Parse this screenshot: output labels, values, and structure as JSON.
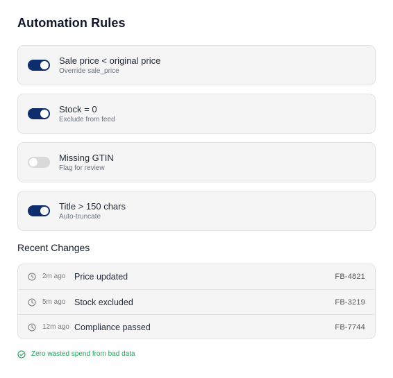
{
  "page": {
    "title": "Automation Rules"
  },
  "rules": [
    {
      "enabled": true,
      "title": "Sale price < original price",
      "subtitle": "Override sale_price"
    },
    {
      "enabled": true,
      "title": "Stock = 0",
      "subtitle": "Exclude from feed"
    },
    {
      "enabled": false,
      "title": "Missing GTIN",
      "subtitle": "Flag for review"
    },
    {
      "enabled": true,
      "title": "Title > 150 chars",
      "subtitle": "Auto-truncate"
    }
  ],
  "recent_changes": {
    "heading": "Recent Changes",
    "items": [
      {
        "time": "2m ago",
        "event": "Price updated",
        "id": "FB-4821"
      },
      {
        "time": "5m ago",
        "event": "Stock excluded",
        "id": "FB-3219"
      },
      {
        "time": "12m ago",
        "event": "Compliance passed",
        "id": "FB-7744"
      }
    ]
  },
  "footer": {
    "text": "Zero wasted spend from bad data",
    "icon": "check-circle-icon"
  },
  "colors": {
    "toggle_on": "#0d2d6c",
    "toggle_off": "#d9d9d9",
    "success": "#22a05a"
  }
}
